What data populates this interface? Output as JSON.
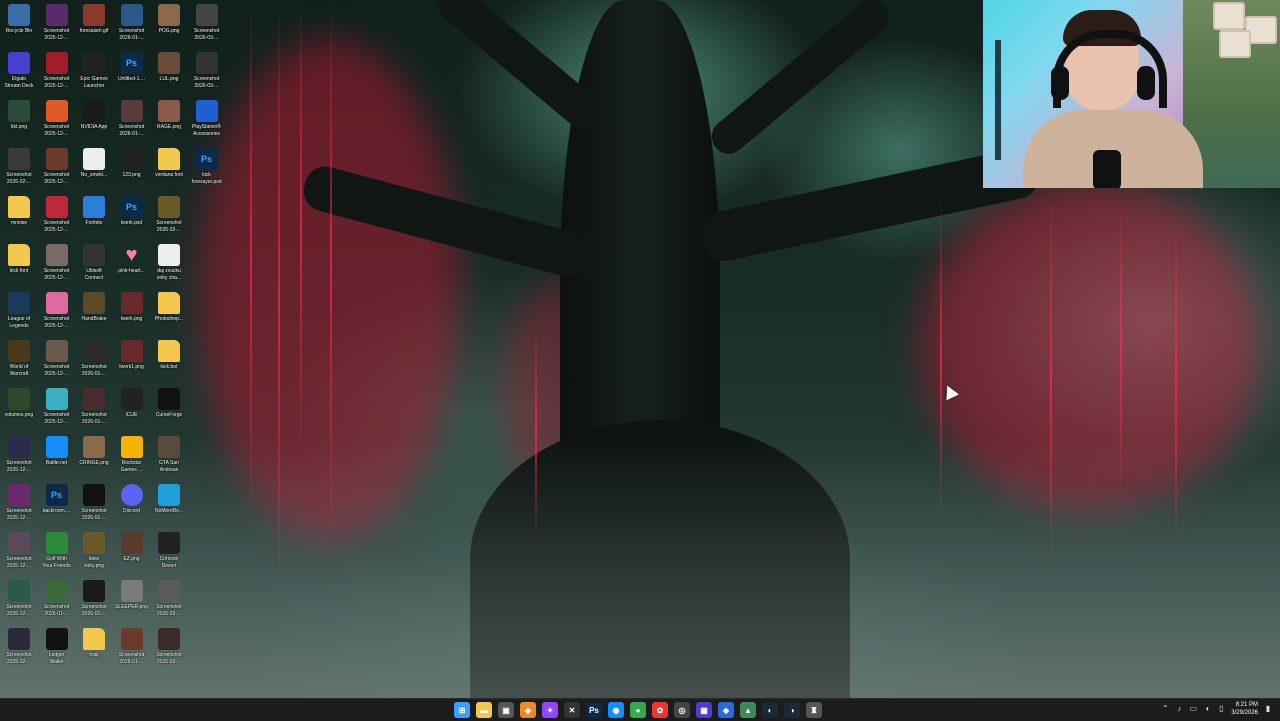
{
  "desktop": {
    "icons": [
      {
        "label": "Recycle Bin",
        "icon": "recycle-bin-icon",
        "color": "#3b6ea8"
      },
      {
        "label": "Screenshot\n2025-12-...",
        "icon": "image-icon",
        "color": "#5a2b6b"
      },
      {
        "label": "foresalam.gif",
        "icon": "image-icon",
        "color": "#8a3a2a"
      },
      {
        "label": "Screenshot\n2026-01-...",
        "icon": "image-icon",
        "color": "#2a5a8a"
      },
      {
        "label": "POG.png",
        "icon": "image-icon",
        "color": "#8a6a4a"
      },
      {
        "label": "Screenshot\n2026-03-...",
        "icon": "image-icon",
        "color": "#444"
      },
      {
        "label": "Elgato\nStream Deck",
        "icon": "stream-deck-icon",
        "color": "#4a3fd1"
      },
      {
        "label": "Screenshot\n2025-12-...",
        "icon": "image-icon",
        "color": "#a31c2a"
      },
      {
        "label": "Epic Games\nLauncher",
        "icon": "epic-games-icon",
        "color": "#222"
      },
      {
        "label": "Untitled-1....",
        "icon": "photoshop-icon",
        "color": "#0b2a4a"
      },
      {
        "label": "LUL.png",
        "icon": "image-icon",
        "color": "#6a4a3a"
      },
      {
        "label": "Screenshot\n2026-03-...",
        "icon": "image-icon",
        "color": "#333"
      },
      {
        "label": "kkt.png",
        "icon": "image-icon",
        "color": "#2a4a3a"
      },
      {
        "label": "Screenshot\n2025-12-...",
        "icon": "firefox-icon",
        "color": "#e0592a"
      },
      {
        "label": "NVIDIA App",
        "icon": "nvidia-icon",
        "color": "#1a1a1a"
      },
      {
        "label": "Screenshot\n2026-01-...",
        "icon": "image-icon",
        "color": "#5a3a3a"
      },
      {
        "label": "RAGE.png",
        "icon": "image-icon",
        "color": "#8a5a4a"
      },
      {
        "label": "PlayStation®\nAccessories",
        "icon": "playstation-icon",
        "color": "#1f5fd1"
      },
      {
        "label": "Screenshot\n2026-02-...",
        "icon": "image-icon",
        "color": "#3a3a3a"
      },
      {
        "label": "Screenshot\n2025-12-...",
        "icon": "image-icon",
        "color": "#6a3a2a"
      },
      {
        "label": "No_smoki...",
        "icon": "no-smoking-icon",
        "color": "#eee"
      },
      {
        "label": "123.png",
        "icon": "image-icon",
        "color": "#222"
      },
      {
        "label": "verdana font",
        "icon": "folder-icon",
        "color": "#f2c94c"
      },
      {
        "label": "kick\nforesayer.psd",
        "icon": "photoshop-icon",
        "color": "#0b2a4a"
      },
      {
        "label": "mnoise",
        "icon": "folder-icon",
        "color": "#f2c94c"
      },
      {
        "label": "Screenshot\n2025-12-...",
        "icon": "image-icon",
        "color": "#c0283a"
      },
      {
        "label": "Fortnite",
        "icon": "fortnite-icon",
        "color": "#2b7fd8"
      },
      {
        "label": "twerk.psd",
        "icon": "photoshop-icon",
        "color": "#0b2a4a"
      },
      {
        "label": "Screenshot\n2026-02-...",
        "icon": "image-icon",
        "color": "#6a5a2a"
      },
      {
        "label": "",
        "icon": "",
        "color": ""
      },
      {
        "label": "kick font",
        "icon": "folder-icon",
        "color": "#f2c94c"
      },
      {
        "label": "Screenshot\n2025-12-...",
        "icon": "image-icon",
        "color": "#7a6a6a"
      },
      {
        "label": "Ubisoft\nConnect",
        "icon": "ubisoft-icon",
        "color": "#333"
      },
      {
        "label": "pink-heart...",
        "icon": "heart-icon",
        "color": "#ff7eb6"
      },
      {
        "label": "daj zvucku\nzeby cha...",
        "icon": "document-icon",
        "color": "#eee"
      },
      {
        "label": "",
        "icon": "",
        "color": ""
      },
      {
        "label": "League of\nLegends",
        "icon": "league-icon",
        "color": "#1a3a5a"
      },
      {
        "label": "Screenshot\n2025-12-...",
        "icon": "image-icon",
        "color": "#e06aa0"
      },
      {
        "label": "HandBrake",
        "icon": "handbrake-icon",
        "color": "#5a4a2a"
      },
      {
        "label": "twerk.png",
        "icon": "image-icon",
        "color": "#6a2a2a"
      },
      {
        "label": "Photoshop...",
        "icon": "folder-icon",
        "color": "#f2c94c"
      },
      {
        "label": "",
        "icon": "",
        "color": ""
      },
      {
        "label": "World of\nWarcraft",
        "icon": "wow-icon",
        "color": "#4a3a1a"
      },
      {
        "label": "Screenshot\n2025-12-...",
        "icon": "image-icon",
        "color": "#6a5a4a"
      },
      {
        "label": "Screenshot\n2026-01-...",
        "icon": "image-icon",
        "color": "#2a2a2a"
      },
      {
        "label": "twerk1.png",
        "icon": "image-icon",
        "color": "#6a2a2a"
      },
      {
        "label": "kick.bot",
        "icon": "folder-icon",
        "color": "#f2c94c"
      },
      {
        "label": "",
        "icon": "",
        "color": ""
      },
      {
        "label": "volumes.png",
        "icon": "image-icon",
        "color": "#2a4a2a"
      },
      {
        "label": "Screenshot\n2025-12-...",
        "icon": "image-icon",
        "color": "#3ab0c0"
      },
      {
        "label": "Screenshot\n2026-01-...",
        "icon": "image-icon",
        "color": "#4a2a2a"
      },
      {
        "label": "iCUE",
        "icon": "icue-icon",
        "color": "#222"
      },
      {
        "label": "CurseForge",
        "icon": "curseforge-icon",
        "color": "#111"
      },
      {
        "label": "",
        "icon": "",
        "color": ""
      },
      {
        "label": "Screenshot\n2025-12-...",
        "icon": "image-icon",
        "color": "#2a2a4a"
      },
      {
        "label": "Battle.net",
        "icon": "battlenet-icon",
        "color": "#148eff"
      },
      {
        "label": "CRINGE.png",
        "icon": "image-icon",
        "color": "#8a6a4a"
      },
      {
        "label": "Rockstar\nGames ...",
        "icon": "rockstar-icon",
        "color": "#f4b400"
      },
      {
        "label": "GTA San\nAndreas",
        "icon": "gta-icon",
        "color": "#5a4a3a"
      },
      {
        "label": "",
        "icon": "",
        "color": ""
      },
      {
        "label": "Screenshot\n2025-12-...",
        "icon": "image-icon",
        "color": "#6a2a6a"
      },
      {
        "label": "backroom....",
        "icon": "photoshop-icon",
        "color": "#0b2a4a"
      },
      {
        "label": "Screenshot\n2026-01-...",
        "icon": "image-icon",
        "color": "#111"
      },
      {
        "label": "Discord",
        "icon": "discord-icon",
        "color": "#5865f2"
      },
      {
        "label": "NoMoreBo...",
        "icon": "app-icon",
        "color": "#1fa0d8"
      },
      {
        "label": "",
        "icon": "",
        "color": ""
      },
      {
        "label": "Screenshot\n2025-12-...",
        "icon": "image-icon",
        "color": "#5a4a5a"
      },
      {
        "label": "Golf With\nYour Friends",
        "icon": "golf-icon",
        "color": "#2a8a3a"
      },
      {
        "label": "biele\nzuby.png",
        "icon": "image-icon",
        "color": "#6a5a2a"
      },
      {
        "label": "EZ.png",
        "icon": "image-icon",
        "color": "#5a3a2a"
      },
      {
        "label": "Crimson\nDesert",
        "icon": "crimson-desert-icon",
        "color": "#222"
      },
      {
        "label": "",
        "icon": "",
        "color": ""
      },
      {
        "label": "Screenshot\n2026-12-...",
        "icon": "image-icon",
        "color": "#2a5a4a"
      },
      {
        "label": "Screenshot\n2026-01-...",
        "icon": "image-icon",
        "color": "#3a6a3a"
      },
      {
        "label": "Screenshot\n2026-01-...",
        "icon": "image-icon",
        "color": "#1a1a1a"
      },
      {
        "label": "SLEEPER.png",
        "icon": "image-icon",
        "color": "#7a7a7a"
      },
      {
        "label": "Screenshot\n2026-03-...",
        "icon": "image-icon",
        "color": "#5a5a5a"
      },
      {
        "label": "",
        "icon": "",
        "color": ""
      },
      {
        "label": "Screenshot\n2025-12-...",
        "icon": "image-icon",
        "color": "#2a2a3a"
      },
      {
        "label": "Ledger\nWallet",
        "icon": "ledger-icon",
        "color": "#111"
      },
      {
        "label": "mist",
        "icon": "folder-icon",
        "color": "#f2c94c"
      },
      {
        "label": "Screenshot\n2026-01-...",
        "icon": "image-icon",
        "color": "#6a3a2a"
      },
      {
        "label": "Screenshot\n2026-03-...",
        "icon": "image-icon",
        "color": "#3a2a2a"
      },
      {
        "label": "",
        "icon": "",
        "color": ""
      }
    ]
  },
  "taskbar": {
    "apps": [
      {
        "name": "start-icon",
        "glyph": "⊞",
        "color": "#3aa0ff"
      },
      {
        "name": "file-explorer-icon",
        "glyph": "▬",
        "color": "#f2c94c"
      },
      {
        "name": "app-icon",
        "glyph": "▣",
        "color": "#555"
      },
      {
        "name": "app-icon",
        "glyph": "◆",
        "color": "#f08a24"
      },
      {
        "name": "twitch-icon",
        "glyph": "✦",
        "color": "#9146ff"
      },
      {
        "name": "app-icon",
        "glyph": "✕",
        "color": "#333"
      },
      {
        "name": "photoshop-icon",
        "glyph": "Ps",
        "color": "#0b2a4a"
      },
      {
        "name": "battlenet-icon",
        "glyph": "◉",
        "color": "#148eff"
      },
      {
        "name": "chrome-icon",
        "glyph": "●",
        "color": "#34a853"
      },
      {
        "name": "app-icon",
        "glyph": "✿",
        "color": "#e33"
      },
      {
        "name": "app-icon",
        "glyph": "◎",
        "color": "#444"
      },
      {
        "name": "stream-deck-icon",
        "glyph": "▦",
        "color": "#4a3fd1"
      },
      {
        "name": "app-icon",
        "glyph": "◈",
        "color": "#2a6ad8"
      },
      {
        "name": "app-icon",
        "glyph": "▲",
        "color": "#3a8a5a"
      },
      {
        "name": "steam-icon",
        "glyph": "◐",
        "color": "#1b2838"
      },
      {
        "name": "steam-icon",
        "glyph": "◑",
        "color": "#1b2838"
      },
      {
        "name": "app-icon",
        "glyph": "♜",
        "color": "#555"
      }
    ],
    "tray": {
      "icons": [
        "chevron-up-icon",
        "speaker-icon",
        "network-icon",
        "volume-icon",
        "battery-icon",
        "notification-icon"
      ],
      "time": "8:21 PM",
      "date": "3/29/2026"
    }
  }
}
